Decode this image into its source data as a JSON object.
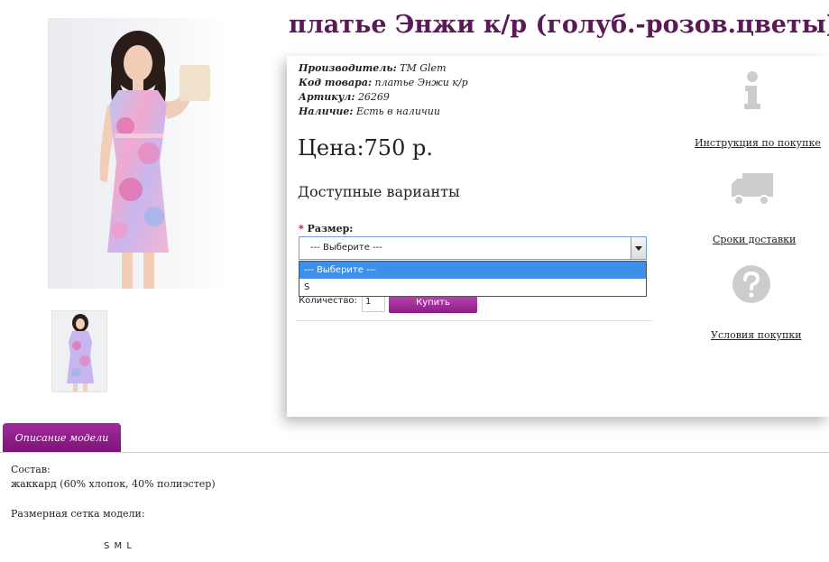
{
  "product": {
    "title": "платье Энжи к/р (голуб.-розов.цветы)",
    "specs": [
      {
        "key": "Производитель:",
        "value": "TM Glem"
      },
      {
        "key": "Код товара:",
        "value": "платье Энжи к/р"
      },
      {
        "key": "Артикул:",
        "value": "26269"
      },
      {
        "key": "Наличие:",
        "value": "Есть в наличии"
      }
    ],
    "price": "Цена:750 р.",
    "available_title": "Доступные варианты"
  },
  "options": {
    "required_mark": "*",
    "size_label": "Размер:",
    "select_value": "--- Выберите ---",
    "dropdown_options": [
      "--- Выберите ---",
      "S"
    ]
  },
  "purchase": {
    "qty_label": "Количество:",
    "qty_value": "1",
    "buy_label": "Купить"
  },
  "side": {
    "links": [
      {
        "label": "Инструкция по покупке",
        "icon": "info-icon"
      },
      {
        "label": "Сроки доставки",
        "icon": "truck-icon"
      },
      {
        "label": "Условия покупки",
        "icon": "question-icon"
      }
    ],
    "icon_color": "#cccccc"
  },
  "tabs": {
    "description_label": "Описание модели"
  },
  "description": {
    "composition_label": "Состав:",
    "composition_value": "жаккард (60% хлопок, 40% полиэстер)",
    "size_chart_label": "Размерная сетка модели:",
    "sizes": "S M L"
  },
  "colors": {
    "brand": "#8c1d86",
    "title": "#5a1a56",
    "selected_option": "#3d8fe8"
  }
}
